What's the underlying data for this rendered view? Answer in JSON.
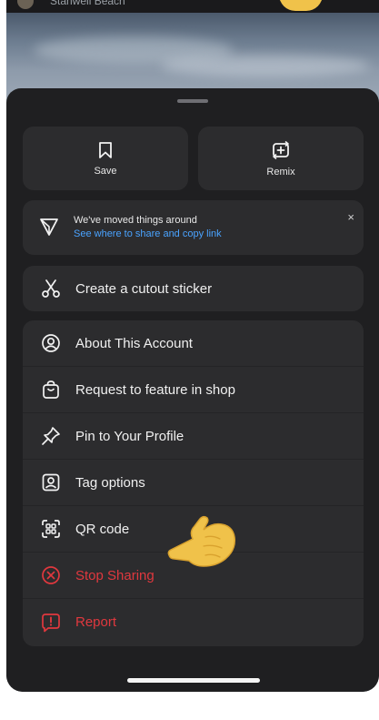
{
  "background": {
    "account_name": "Stanwell Beach"
  },
  "sheet": {
    "save_label": "Save",
    "remix_label": "Remix",
    "notice": {
      "title": "We've moved things around",
      "link": "See where to share and copy link",
      "close": "×"
    },
    "cutout_label": "Create a cutout sticker",
    "items": [
      {
        "label": "About This Account",
        "icon": "account-icon",
        "danger": false
      },
      {
        "label": "Request to feature in shop",
        "icon": "shopping-bag-icon",
        "danger": false
      },
      {
        "label": "Pin to Your Profile",
        "icon": "pin-icon",
        "danger": false
      },
      {
        "label": "Tag options",
        "icon": "tag-person-icon",
        "danger": false
      },
      {
        "label": "QR code",
        "icon": "qr-code-icon",
        "danger": false
      },
      {
        "label": "Stop Sharing",
        "icon": "stop-icon",
        "danger": true
      },
      {
        "label": "Report",
        "icon": "report-icon",
        "danger": true
      }
    ]
  },
  "colors": {
    "sheet_bg": "#1f1f21",
    "card_bg": "#2c2c2e",
    "link_blue": "#4aa3ff",
    "danger_red": "#e0383e"
  },
  "decorations": [
    "pointing-hand-emoji"
  ]
}
